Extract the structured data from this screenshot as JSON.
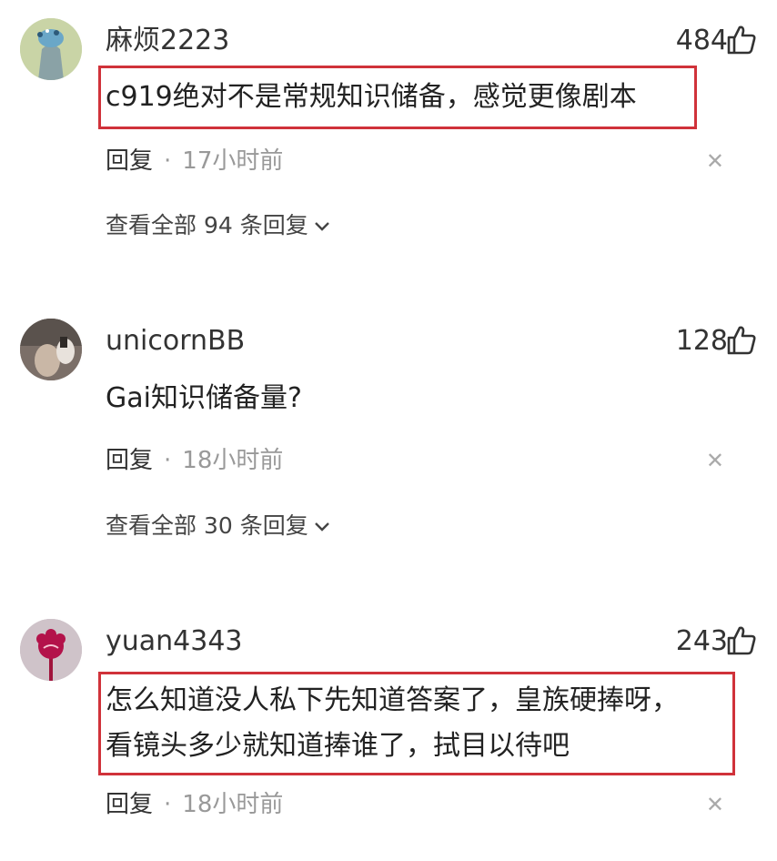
{
  "comments": [
    {
      "username": "麻烦2223",
      "likes": "484",
      "text_lines": [
        "c919绝对不是常规知识储备，感觉更像剧本"
      ],
      "reply_label": "回复",
      "separator": "·",
      "time": "17小时前",
      "view_all": "查看全部 94 条回复",
      "avatar_icon": "balloon-avatar"
    },
    {
      "username": "unicornBB",
      "likes": "128",
      "text_lines": [
        "Gai知识储备量?"
      ],
      "reply_label": "回复",
      "separator": "·",
      "time": "18小时前",
      "view_all": "查看全部 30 条回复",
      "avatar_icon": "photo-avatar"
    },
    {
      "username": "yuan4343",
      "likes": "243",
      "text_lines": [
        "怎么知道没人私下先知道答案了，皇族硬捧呀，",
        "看镜头多少就知道捧谁了，拭目以待吧"
      ],
      "reply_label": "回复",
      "separator": "·",
      "time": "18小时前",
      "avatar_icon": "flower-avatar"
    }
  ],
  "colors": {
    "highlight_border": "#d0323a",
    "muted_text": "#999999"
  }
}
